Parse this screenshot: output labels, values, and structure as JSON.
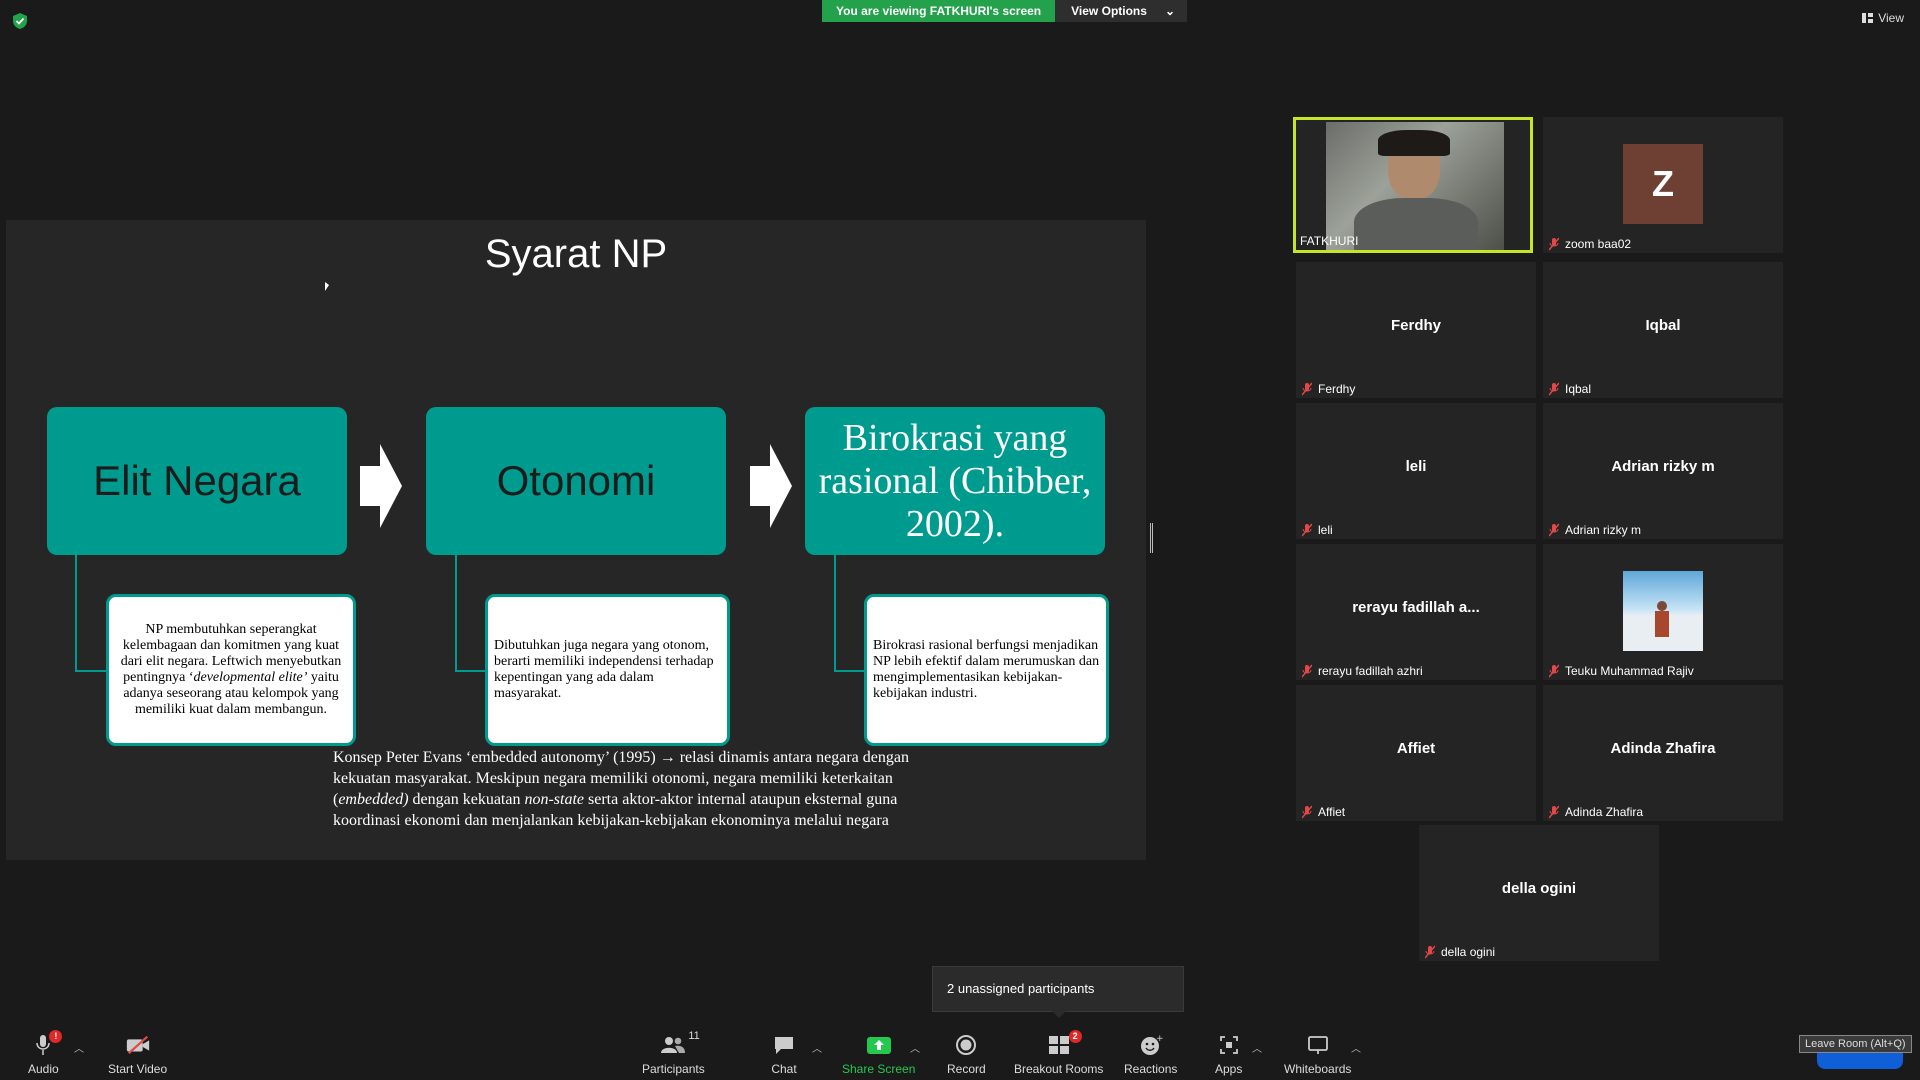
{
  "top_banner": {
    "viewing_text": "You are viewing FATKHURI's screen",
    "view_options_label": "View Options",
    "view_button_label": "View"
  },
  "slide": {
    "title": "Syarat NP",
    "boxes": [
      "Elit Negara",
      "Otonomi",
      "Birokrasi yang rasional (Chibber, 2002)."
    ],
    "sub1": {
      "part1": "NP membutuhkan seperangkat kelembagaan dan komitmen yang kuat dari elit negara.  Leftwich menyebutkan pentingnya ‘",
      "italic": "developmental elite’",
      "part2": " yaitu adanya seseorang atau kelompok yang memiliki kuat dalam membangun."
    },
    "sub2": "Dibutuhkan juga negara yang otonom, berarti memiliki independensi terhadap kepentingan yang ada dalam masyarakat.",
    "sub3": "Birokrasi rasional berfungsi menjadikan NP lebih efektif dalam merumuskan dan mengimplementasikan kebijakan-kebijakan industri.",
    "footer": {
      "p1": "Konsep Peter Evans ‘embedded autonomy’ (1995) → relasi dinamis antara negara dengan kekuatan masyarakat. Meskipun negara memiliki otonomi, negara memiliki keterkaitan (",
      "i1": "embedded)",
      "p2": " dengan kekuatan ",
      "i2": "non-state",
      "p3": " serta aktor-aktor internal ataupun eksternal  guna koordinasi ekonomi dan menjalankan kebijakan-kebijakan ekonominya melalui negara"
    }
  },
  "participants": [
    {
      "center": "",
      "name": "FATKHURI"
    },
    {
      "center": "Z",
      "name": "zoom baa02"
    },
    {
      "center": "Ferdhy",
      "name": "Ferdhy"
    },
    {
      "center": "Iqbal",
      "name": "Iqbal"
    },
    {
      "center": "leli",
      "name": "leli"
    },
    {
      "center": "Adrian rizky m",
      "name": "Adrian rizky m"
    },
    {
      "center": "rerayu fadillah a...",
      "name": "rerayu fadillah azhri"
    },
    {
      "center": "",
      "name": "Teuku Muhammad Rajiv"
    },
    {
      "center": "Affiet",
      "name": "Affiet"
    },
    {
      "center": "Adinda Zhafira",
      "name": "Adinda Zhafira"
    },
    {
      "center": "della ogini",
      "name": "della ogini"
    }
  ],
  "unassigned_popup": "2 unassigned participants",
  "toolbar": {
    "audio": "Audio",
    "audio_badge": "!",
    "start_video": "Start Video",
    "participants": "Participants",
    "participants_count": "11",
    "chat": "Chat",
    "share_screen": "Share Screen",
    "record": "Record",
    "breakout_rooms": "Breakout Rooms",
    "breakout_badge": "2",
    "reactions": "Reactions",
    "apps": "Apps",
    "whiteboards": "Whiteboards",
    "leave_tooltip": "Leave Room (Alt+Q)"
  },
  "colors": {
    "banner_green": "#23a14b",
    "slide_teal": "#009b8f",
    "active_speaker_border": "#c3e629",
    "share_green": "#24c84e"
  }
}
